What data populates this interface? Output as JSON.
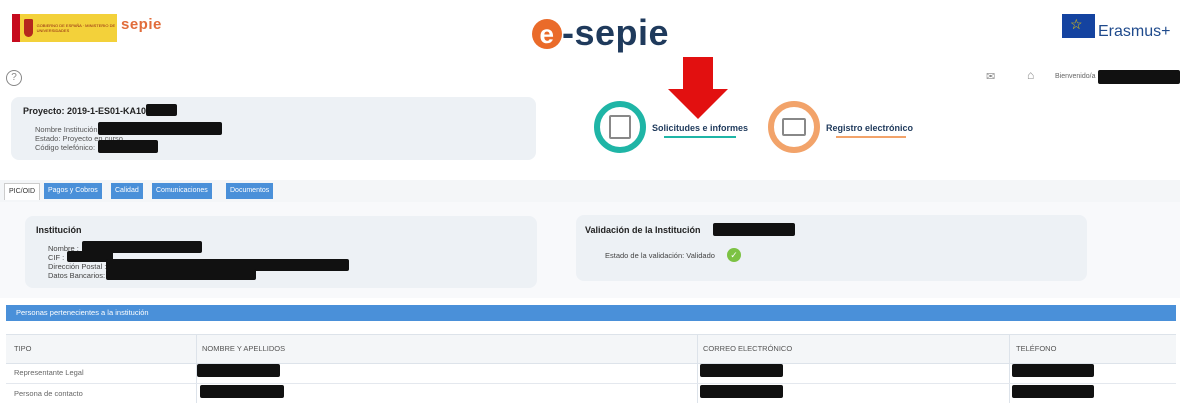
{
  "header": {
    "gov_text": "GOBIERNO DE ESPAÑA · MINISTERIO DE UNIVERSIDADES",
    "sepie_logo": "sepie",
    "brand_e": "e",
    "brand_rest": "-sepie",
    "erasmus": "Erasmus+",
    "help": "?",
    "welcome": "Bienvenido/a"
  },
  "project": {
    "title": "Proyecto: 2019-1-ES01-KA107-",
    "nombre_label": "Nombre Institución",
    "estado_label": "Estado:",
    "estado_value": "Proyecto en curso",
    "codigo_label": "Código telefónico:"
  },
  "quick_links": {
    "solicitudes": "Solicitudes e informes",
    "registro": "Registro electrónico"
  },
  "tabs": [
    {
      "label": "PIC/OID",
      "active": true
    },
    {
      "label": "Pagos y Cobros",
      "active": false
    },
    {
      "label": "Calidad",
      "active": false
    },
    {
      "label": "Comunicaciones",
      "active": false
    },
    {
      "label": "Documentos",
      "active": false
    }
  ],
  "institucion": {
    "title": "Institución",
    "nombre_label": "Nombre :",
    "cif_label": "CIF :",
    "direccion_label": "Dirección Postal :",
    "bancarios_label": "Datos Bancarios:"
  },
  "validacion": {
    "title": "Validación de la Institución",
    "estado_label": "Estado de la validación: Validado"
  },
  "personas": {
    "title": "Personas pertenecientes a la institución",
    "columns": [
      "TIPO",
      "NOMBRE Y APELLIDOS",
      "CORREO ELECTRÓNICO",
      "TELÉFONO"
    ],
    "rows": [
      {
        "tipo": "Representante Legal"
      },
      {
        "tipo": "Persona de contacto"
      }
    ]
  },
  "colors": {
    "accent_blue": "#4a90d9",
    "teal": "#1fb5a6",
    "orange": "#f2a36a",
    "arrow_red": "#e21010",
    "validated_green": "#7cc243"
  },
  "icons": [
    "help-icon",
    "mail-icon",
    "home-icon",
    "documents-icon",
    "envelope-icon",
    "check-icon"
  ]
}
